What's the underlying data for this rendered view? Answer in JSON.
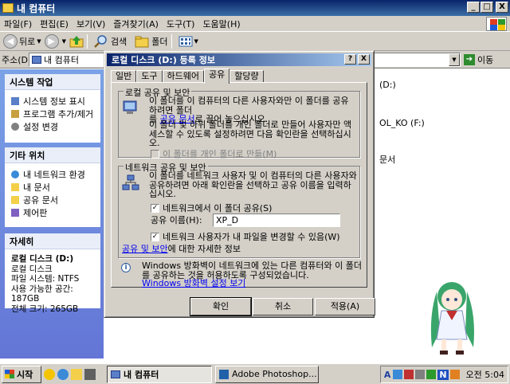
{
  "window": {
    "title": "내 컴퓨터",
    "controls": {
      "minimize": "_",
      "maximize": "□",
      "close": "X"
    }
  },
  "menu": {
    "items": [
      "파일(F)",
      "편집(E)",
      "보기(V)",
      "즐겨찾기(A)",
      "도구(T)",
      "도움말(H)"
    ]
  },
  "toolbar": {
    "back": "뒤로",
    "search": "검색",
    "folders": "폴더"
  },
  "address": {
    "label": "주소(D)",
    "value": "내 컴퓨터",
    "go": "이동"
  },
  "taskpane": {
    "system": {
      "title": "시스템 작업",
      "items": [
        "시스템 정보 표시",
        "프로그램 추가/제거",
        "설정 변경"
      ]
    },
    "other": {
      "title": "기타 위치",
      "items": [
        "내 네트워크 환경",
        "내 문서",
        "공유 문서",
        "제어판"
      ]
    },
    "details": {
      "title": "자세히",
      "name": "로컬 디스크 (D:)",
      "type": "로컬 디스크",
      "fs": "파일 시스템: NTFS",
      "free": "사용 가능한 공간: 187GB",
      "total": "전체 크기: 265GB"
    }
  },
  "content": {
    "item1": "(D:)",
    "item2": "OL_KO (F:)",
    "item3": "문서"
  },
  "dialog": {
    "title": "로컬 디스크 (D:) 등록 정보",
    "help": "?",
    "close": "X",
    "tabs": [
      "일반",
      "도구",
      "하드웨어",
      "공유",
      "할당량"
    ],
    "local": {
      "title": "로컬 공유 및 보안",
      "text1a": "이 폴더를 이 컴퓨터의 다른 사용자와만 이 폴더를 공유하려면 폴더",
      "text1b_pre": "를",
      "text1b_link": "공유 문서",
      "text1b_post": "로 끌어 놓으십시오.",
      "text2": "이 폴더 및 하위 폴더를 개인 폴더로 만들어 사용자만 액세스할 수 있도록 설정하려면 다음 확인란을 선택하십시오.",
      "private_checkbox": "이 폴더를 개인 폴더로 만듦(M)"
    },
    "network": {
      "title": "네트워크 공유 및 보안",
      "text": "이 폴더를 네트워크 사용자 및 이 컴퓨터의 다른 사용자와 공유하려면 아래 확인란을 선택하고 공유 이름을 입력하십시오.",
      "share_checkbox": "네트워크에서 이 폴더 공유(S)",
      "share_name_label": "공유 이름(H):",
      "share_name_value": "XP_D",
      "allow_change_checkbox": "네트워크 사용자가 내 파일을 변경할 수 있음(W)",
      "learn_link": "공유 및 보안",
      "learn_post": "에 대한 자세한 정보"
    },
    "firewall": {
      "text": "Windows 방화벽이 네트워크에 있는 다른 컴퓨터와 이 폴더를 공유하는 것을 허용하도록 구성되었습니다.",
      "link": "Windows 방화벽 설정 보기",
      "info_glyph": "i"
    },
    "buttons": {
      "ok": "확인",
      "cancel": "취소",
      "apply": "적용(A)"
    }
  },
  "taskbar": {
    "start": "시작",
    "tasks": [
      "내 컴퓨터",
      "Adobe Photoshop..."
    ],
    "tray_a": "A",
    "tray_n": "N",
    "clock": "오전 5:04"
  },
  "colors": {
    "face": "#d4d0c8",
    "title_active": "#0a246a",
    "taskpane": "#7ba2e7",
    "link": "#0000ee"
  }
}
